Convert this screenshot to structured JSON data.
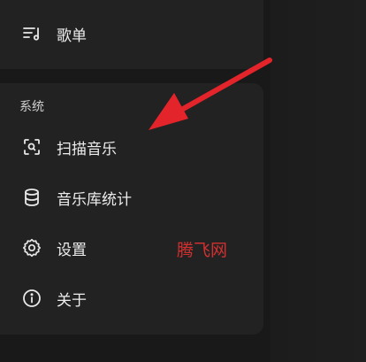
{
  "menu_top": {
    "playlist": {
      "label": "歌单",
      "icon": "playlist-icon"
    }
  },
  "system": {
    "title": "系统",
    "items": [
      {
        "label": "扫描音乐",
        "icon": "scan-icon"
      },
      {
        "label": "音乐库统计",
        "icon": "database-icon"
      },
      {
        "label": "设置",
        "icon": "gear-icon"
      },
      {
        "label": "关于",
        "icon": "info-icon"
      }
    ]
  },
  "watermark": "腾飞网",
  "colors": {
    "arrow": "#e3242b",
    "watermark": "#d23030",
    "card": "#222222"
  }
}
